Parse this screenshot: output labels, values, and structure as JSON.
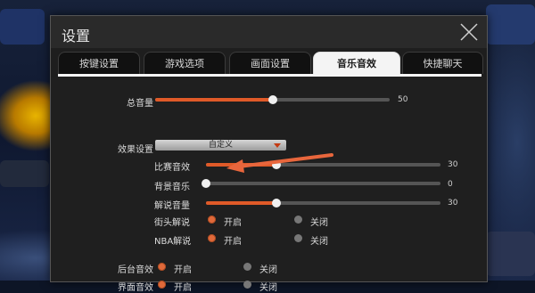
{
  "dialog": {
    "title": "设置"
  },
  "tabs": [
    {
      "label": "按键设置",
      "active": false
    },
    {
      "label": "游戏选项",
      "active": false
    },
    {
      "label": "画面设置",
      "active": false
    },
    {
      "label": "音乐音效",
      "active": true
    },
    {
      "label": "快捷聊天",
      "active": false
    }
  ],
  "master_volume": {
    "label": "总音量",
    "value": "50",
    "fraction": 0.5
  },
  "effects": {
    "label": "效果设置",
    "preset": "自定义",
    "sliders": [
      {
        "label": "比赛音效",
        "value": "30",
        "fraction": 0.3
      },
      {
        "label": "背景音乐",
        "value": "0",
        "fraction": 0.0
      },
      {
        "label": "解说音量",
        "value": "30",
        "fraction": 0.3
      }
    ],
    "radios": [
      {
        "label": "街头解说",
        "on": "开启",
        "off": "关闭",
        "selected": "on"
      },
      {
        "label": "NBA解说",
        "on": "开启",
        "off": "关闭",
        "selected": "on"
      }
    ]
  },
  "global_radios": [
    {
      "label": "后台音效",
      "on": "开启",
      "off": "关闭",
      "selected": "on"
    },
    {
      "label": "界面音效",
      "on": "开启",
      "off": "关闭",
      "selected": "on"
    }
  ],
  "colors": {
    "accent": "#e05a28",
    "annotation_arrow": "#e8663c"
  }
}
